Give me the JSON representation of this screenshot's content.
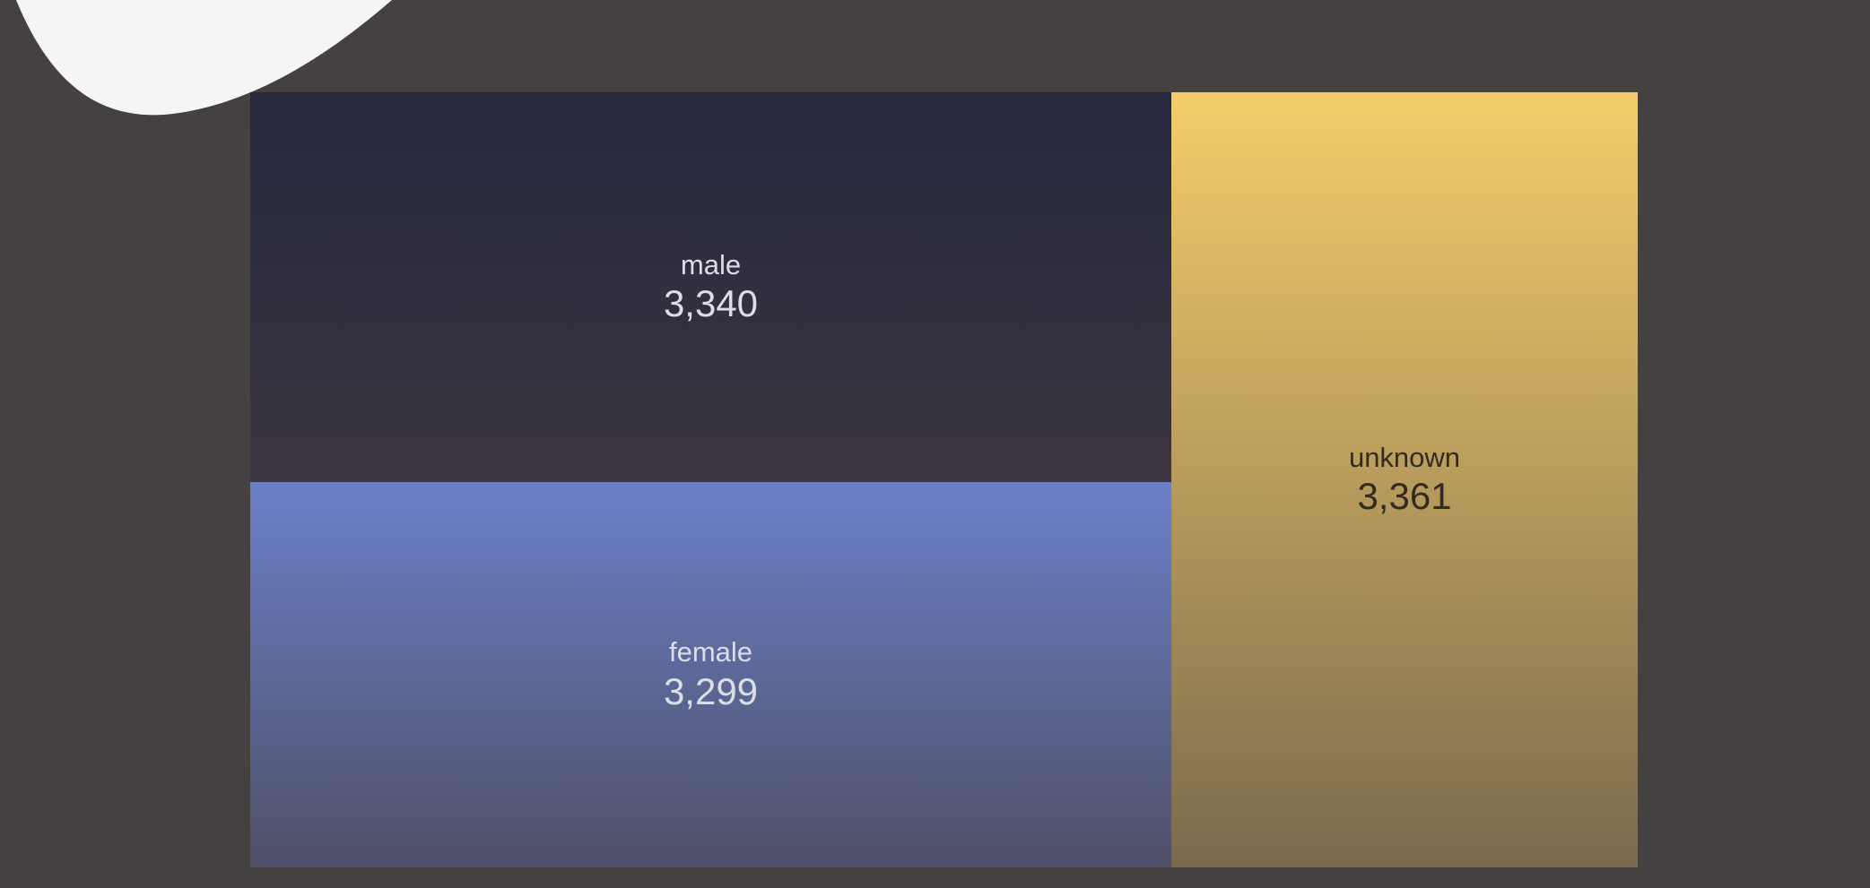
{
  "chart_data": {
    "type": "treemap",
    "title": "",
    "tiles": [
      {
        "name": "unknown",
        "value": 3361,
        "value_label": "3,361",
        "color_top": "#f6cd6b",
        "color_bottom": "#7a6a4d",
        "text_color": "#332b1e"
      },
      {
        "name": "male",
        "value": 3340,
        "value_label": "3,340",
        "color_top": "#262840",
        "color_bottom": "#3b363f",
        "text_color": "#dcdde6"
      },
      {
        "name": "female",
        "value": 3299,
        "value_label": "3,299",
        "color_top": "#6a80c8",
        "color_bottom": "#4f5068",
        "text_color": "#dcdde6"
      }
    ]
  },
  "colors": {
    "background": "#464141",
    "blob": "#f5f5f5"
  }
}
